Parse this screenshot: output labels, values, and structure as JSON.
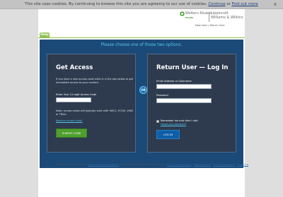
{
  "cookie_bar": {
    "text": "This site uses cookies. By continuing to browse this site you are agreeing to our use of cookies.",
    "continue_label": "Continue",
    "or_text": "or",
    "find_more_label": "Find out more",
    "close_label": "x"
  },
  "brand": {
    "left_name": "Wolters Kluwer",
    "health": "Health",
    "right_lines": [
      "Lippincott",
      "Williams & Wilkins"
    ]
  },
  "header_links": {
    "new_user": "New User",
    "separator": "|",
    "return_user": "Return User"
  },
  "help_tab": "Help",
  "main": {
    "choose_text": "Please choose one of these two options:",
    "or_label": "OR",
    "access": {
      "title": "Get Access",
      "intro": "If you have a new access code enter it in the box below to get immediate access to your content.",
      "code_label": "Enter Your 12-digit Access Code",
      "note": "Note: access codes will typically start with 9WC2, ECON, 2RXC or TRIAL.",
      "need_link": "Need an access code?",
      "submit_label": "SUBMIT CODE"
    },
    "login": {
      "title": "Return User — Log In",
      "email_label": "Email Address or Username",
      "password_label": "Password",
      "remember_label": "Remember me next time I visit.",
      "forgot_link": "Forgot your password?",
      "login_label": "LOG IN"
    }
  },
  "footer": {
    "copyright": "All material copyright ©2023",
    "lww_link": "Lippincott Williams & Wilkins",
    "rest": ", parts of its publications. All rights reserved.",
    "privacy": "Privacy & Cookie Policy",
    "legal": "Legal Disclaimer",
    "technical": "Technical Assistance",
    "contact": "Contact Us",
    "sep": " | "
  }
}
